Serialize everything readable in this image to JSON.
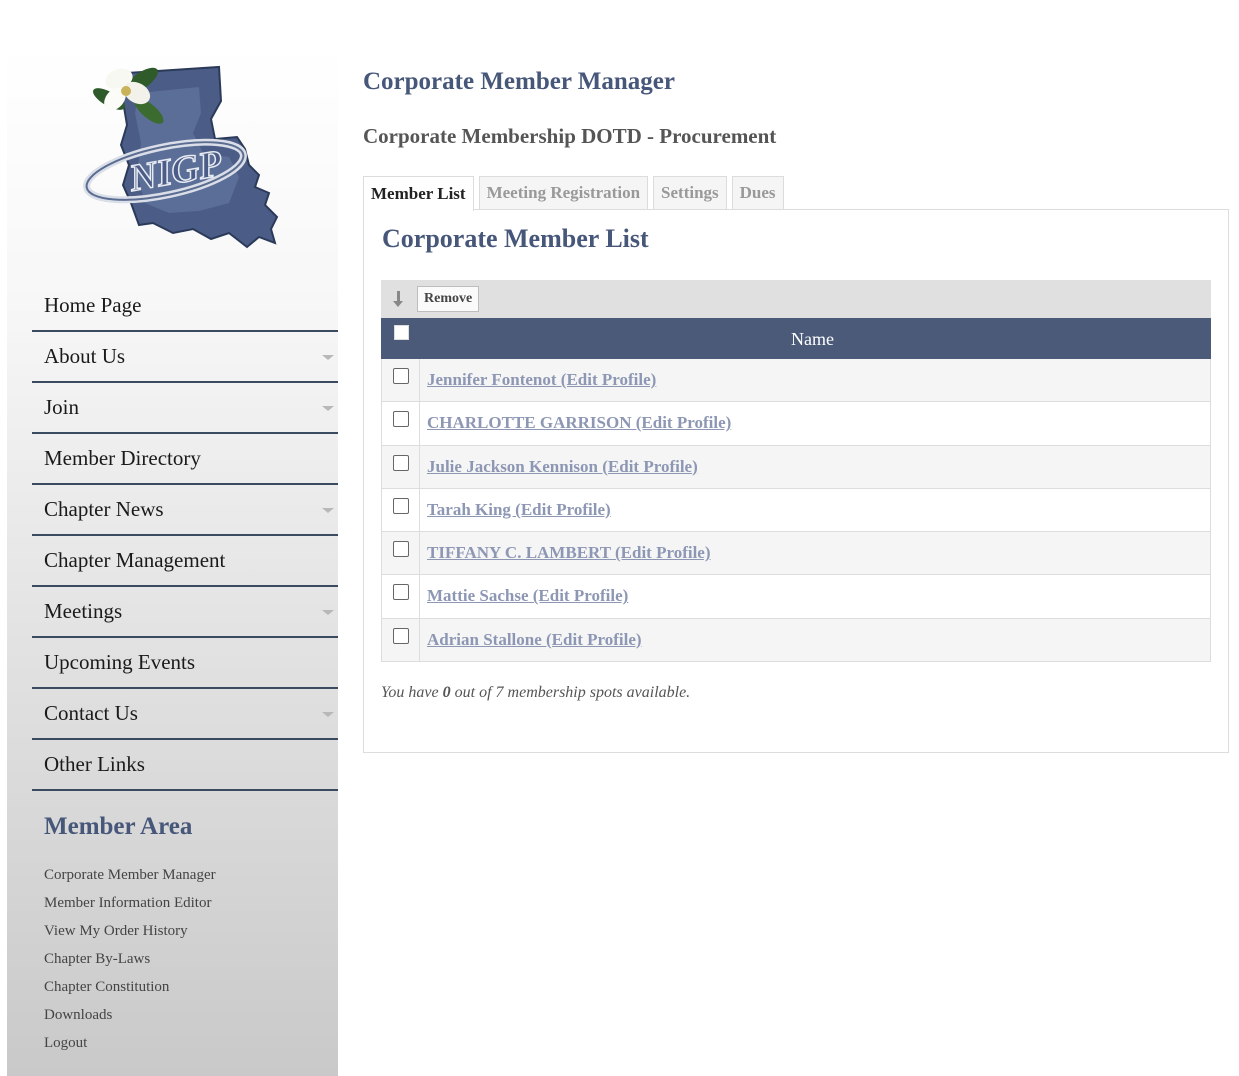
{
  "sidebar": {
    "logo_text": "NIGP",
    "nav": [
      {
        "label": "Home Page",
        "has_submenu": false
      },
      {
        "label": "About Us",
        "has_submenu": true
      },
      {
        "label": "Join",
        "has_submenu": true
      },
      {
        "label": "Member Directory",
        "has_submenu": false
      },
      {
        "label": "Chapter News",
        "has_submenu": true
      },
      {
        "label": "Chapter Management",
        "has_submenu": false
      },
      {
        "label": "Meetings",
        "has_submenu": true
      },
      {
        "label": "Upcoming Events",
        "has_submenu": false
      },
      {
        "label": "Contact Us",
        "has_submenu": true
      },
      {
        "label": "Other Links",
        "has_submenu": false
      }
    ],
    "member_area": {
      "title": "Member Area",
      "links": [
        "Corporate Member Manager",
        "Member Information Editor",
        "View My Order History",
        "Chapter By-Laws",
        "Chapter Constitution",
        "Downloads",
        "Logout"
      ]
    }
  },
  "main": {
    "title": "Corporate Member Manager",
    "subtitle": "Corporate Membership DOTD - Procurement",
    "tabs": [
      {
        "label": "Member List",
        "active": true
      },
      {
        "label": "Meeting Registration",
        "active": false
      },
      {
        "label": "Settings",
        "active": false
      },
      {
        "label": "Dues",
        "active": false
      }
    ],
    "panel_title": "Corporate Member List",
    "toolbar": {
      "remove_label": "Remove"
    },
    "table": {
      "column_name": "Name",
      "rows": [
        "Jennifer Fontenot (Edit Profile)",
        "CHARLOTTE GARRISON (Edit Profile)",
        "Julie Jackson Kennison (Edit Profile)",
        "Tarah King (Edit Profile)",
        "TIFFANY C. LAMBERT (Edit Profile)",
        "Mattie Sachse (Edit Profile)",
        "Adrian Stallone (Edit Profile)"
      ]
    },
    "footnote": {
      "prefix": "You have ",
      "available": "0",
      "suffix": " out of 7 membership spots available."
    }
  },
  "colors": {
    "heading": "#47577a",
    "table_header": "#4a5a78",
    "link": "#8d97b4",
    "nav_divider": "#3b4a5e"
  }
}
